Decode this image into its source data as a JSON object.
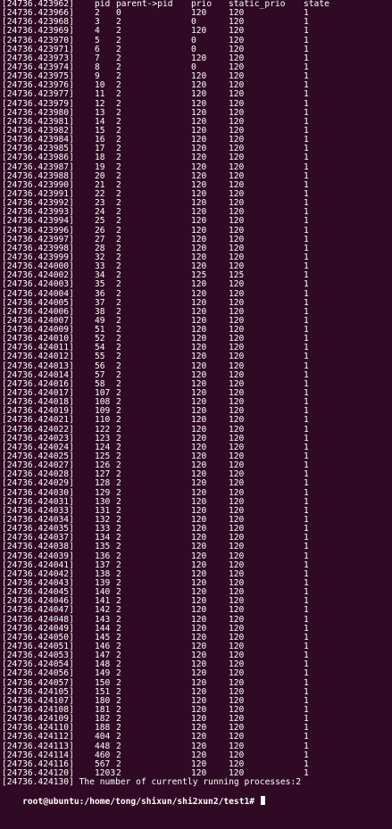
{
  "terminal": {
    "header": {
      "ts": "[24736.423962]",
      "pid": "pid",
      "ppid": "parent->pid",
      "prio": "prio",
      "static_prio": "static_prio",
      "state": "state"
    },
    "rows": [
      {
        "ts": "[24736.423966]",
        "pid": "2",
        "ppid": "0",
        "prio": "120",
        "static_prio": "120",
        "state": "1"
      },
      {
        "ts": "[24736.423968]",
        "pid": "3",
        "ppid": "2",
        "prio": "0",
        "static_prio": "120",
        "state": "1"
      },
      {
        "ts": "[24736.423969]",
        "pid": "4",
        "ppid": "2",
        "prio": "120",
        "static_prio": "120",
        "state": "1"
      },
      {
        "ts": "[24736.423970]",
        "pid": "5",
        "ppid": "2",
        "prio": "0",
        "static_prio": "120",
        "state": "1"
      },
      {
        "ts": "[24736.423971]",
        "pid": "6",
        "ppid": "2",
        "prio": "0",
        "static_prio": "120",
        "state": "1"
      },
      {
        "ts": "[24736.423973]",
        "pid": "7",
        "ppid": "2",
        "prio": "120",
        "static_prio": "120",
        "state": "1"
      },
      {
        "ts": "[24736.423974]",
        "pid": "8",
        "ppid": "2",
        "prio": "0",
        "static_prio": "120",
        "state": "1"
      },
      {
        "ts": "[24736.423975]",
        "pid": "9",
        "ppid": "2",
        "prio": "120",
        "static_prio": "120",
        "state": "1"
      },
      {
        "ts": "[24736.423976]",
        "pid": "10",
        "ppid": "2",
        "prio": "120",
        "static_prio": "120",
        "state": "1"
      },
      {
        "ts": "[24736.423977]",
        "pid": "11",
        "ppid": "2",
        "prio": "120",
        "static_prio": "120",
        "state": "1"
      },
      {
        "ts": "[24736.423979]",
        "pid": "12",
        "ppid": "2",
        "prio": "120",
        "static_prio": "120",
        "state": "1"
      },
      {
        "ts": "[24736.423980]",
        "pid": "13",
        "ppid": "2",
        "prio": "120",
        "static_prio": "120",
        "state": "1"
      },
      {
        "ts": "[24736.423981]",
        "pid": "14",
        "ppid": "2",
        "prio": "120",
        "static_prio": "120",
        "state": "1"
      },
      {
        "ts": "[24736.423982]",
        "pid": "15",
        "ppid": "2",
        "prio": "120",
        "static_prio": "120",
        "state": "1"
      },
      {
        "ts": "[24736.423984]",
        "pid": "16",
        "ppid": "2",
        "prio": "120",
        "static_prio": "120",
        "state": "1"
      },
      {
        "ts": "[24736.423985]",
        "pid": "17",
        "ppid": "2",
        "prio": "120",
        "static_prio": "120",
        "state": "1"
      },
      {
        "ts": "[24736.423986]",
        "pid": "18",
        "ppid": "2",
        "prio": "120",
        "static_prio": "120",
        "state": "1"
      },
      {
        "ts": "[24736.423987]",
        "pid": "19",
        "ppid": "2",
        "prio": "120",
        "static_prio": "120",
        "state": "1"
      },
      {
        "ts": "[24736.423988]",
        "pid": "20",
        "ppid": "2",
        "prio": "120",
        "static_prio": "120",
        "state": "1"
      },
      {
        "ts": "[24736.423990]",
        "pid": "21",
        "ppid": "2",
        "prio": "120",
        "static_prio": "120",
        "state": "1"
      },
      {
        "ts": "[24736.423991]",
        "pid": "22",
        "ppid": "2",
        "prio": "120",
        "static_prio": "120",
        "state": "1"
      },
      {
        "ts": "[24736.423992]",
        "pid": "23",
        "ppid": "2",
        "prio": "120",
        "static_prio": "120",
        "state": "1"
      },
      {
        "ts": "[24736.423993]",
        "pid": "24",
        "ppid": "2",
        "prio": "120",
        "static_prio": "120",
        "state": "1"
      },
      {
        "ts": "[24736.423994]",
        "pid": "25",
        "ppid": "2",
        "prio": "120",
        "static_prio": "120",
        "state": "1"
      },
      {
        "ts": "[24736.423996]",
        "pid": "26",
        "ppid": "2",
        "prio": "120",
        "static_prio": "120",
        "state": "1"
      },
      {
        "ts": "[24736.423997]",
        "pid": "27",
        "ppid": "2",
        "prio": "120",
        "static_prio": "120",
        "state": "1"
      },
      {
        "ts": "[24736.423998]",
        "pid": "28",
        "ppid": "2",
        "prio": "120",
        "static_prio": "120",
        "state": "1"
      },
      {
        "ts": "[24736.423999]",
        "pid": "32",
        "ppid": "2",
        "prio": "120",
        "static_prio": "120",
        "state": "1"
      },
      {
        "ts": "[24736.424000]",
        "pid": "33",
        "ppid": "2",
        "prio": "120",
        "static_prio": "120",
        "state": "1"
      },
      {
        "ts": "[24736.424002]",
        "pid": "34",
        "ppid": "2",
        "prio": "125",
        "static_prio": "125",
        "state": "1"
      },
      {
        "ts": "[24736.424003]",
        "pid": "35",
        "ppid": "2",
        "prio": "120",
        "static_prio": "120",
        "state": "1"
      },
      {
        "ts": "[24736.424004]",
        "pid": "36",
        "ppid": "2",
        "prio": "120",
        "static_prio": "120",
        "state": "1"
      },
      {
        "ts": "[24736.424005]",
        "pid": "37",
        "ppid": "2",
        "prio": "120",
        "static_prio": "120",
        "state": "1"
      },
      {
        "ts": "[24736.424006]",
        "pid": "38",
        "ppid": "2",
        "prio": "120",
        "static_prio": "120",
        "state": "1"
      },
      {
        "ts": "[24736.424007]",
        "pid": "49",
        "ppid": "2",
        "prio": "120",
        "static_prio": "120",
        "state": "1"
      },
      {
        "ts": "[24736.424009]",
        "pid": "51",
        "ppid": "2",
        "prio": "120",
        "static_prio": "120",
        "state": "1"
      },
      {
        "ts": "[24736.424010]",
        "pid": "52",
        "ppid": "2",
        "prio": "120",
        "static_prio": "120",
        "state": "1"
      },
      {
        "ts": "[24736.424011]",
        "pid": "54",
        "ppid": "2",
        "prio": "120",
        "static_prio": "120",
        "state": "1"
      },
      {
        "ts": "[24736.424012]",
        "pid": "55",
        "ppid": "2",
        "prio": "120",
        "static_prio": "120",
        "state": "1"
      },
      {
        "ts": "[24736.424013]",
        "pid": "56",
        "ppid": "2",
        "prio": "120",
        "static_prio": "120",
        "state": "1"
      },
      {
        "ts": "[24736.424014]",
        "pid": "57",
        "ppid": "2",
        "prio": "120",
        "static_prio": "120",
        "state": "1"
      },
      {
        "ts": "[24736.424016]",
        "pid": "58",
        "ppid": "2",
        "prio": "120",
        "static_prio": "120",
        "state": "1"
      },
      {
        "ts": "[24736.424017]",
        "pid": "107",
        "ppid": "2",
        "prio": "120",
        "static_prio": "120",
        "state": "1"
      },
      {
        "ts": "[24736.424018]",
        "pid": "108",
        "ppid": "2",
        "prio": "120",
        "static_prio": "120",
        "state": "1"
      },
      {
        "ts": "[24736.424019]",
        "pid": "109",
        "ppid": "2",
        "prio": "120",
        "static_prio": "120",
        "state": "1"
      },
      {
        "ts": "[24736.424021]",
        "pid": "110",
        "ppid": "2",
        "prio": "120",
        "static_prio": "120",
        "state": "1"
      },
      {
        "ts": "[24736.424022]",
        "pid": "122",
        "ppid": "2",
        "prio": "120",
        "static_prio": "120",
        "state": "1"
      },
      {
        "ts": "[24736.424023]",
        "pid": "123",
        "ppid": "2",
        "prio": "120",
        "static_prio": "120",
        "state": "1"
      },
      {
        "ts": "[24736.424024]",
        "pid": "124",
        "ppid": "2",
        "prio": "120",
        "static_prio": "120",
        "state": "1"
      },
      {
        "ts": "[24736.424025]",
        "pid": "125",
        "ppid": "2",
        "prio": "120",
        "static_prio": "120",
        "state": "1"
      },
      {
        "ts": "[24736.424027]",
        "pid": "126",
        "ppid": "2",
        "prio": "120",
        "static_prio": "120",
        "state": "1"
      },
      {
        "ts": "[24736.424028]",
        "pid": "127",
        "ppid": "2",
        "prio": "120",
        "static_prio": "120",
        "state": "1"
      },
      {
        "ts": "[24736.424029]",
        "pid": "128",
        "ppid": "2",
        "prio": "120",
        "static_prio": "120",
        "state": "1"
      },
      {
        "ts": "[24736.424030]",
        "pid": "129",
        "ppid": "2",
        "prio": "120",
        "static_prio": "120",
        "state": "1"
      },
      {
        "ts": "[24736.424031]",
        "pid": "130",
        "ppid": "2",
        "prio": "120",
        "static_prio": "120",
        "state": "1"
      },
      {
        "ts": "[24736.424033]",
        "pid": "131",
        "ppid": "2",
        "prio": "120",
        "static_prio": "120",
        "state": "1"
      },
      {
        "ts": "[24736.424034]",
        "pid": "132",
        "ppid": "2",
        "prio": "120",
        "static_prio": "120",
        "state": "1"
      },
      {
        "ts": "[24736.424035]",
        "pid": "133",
        "ppid": "2",
        "prio": "120",
        "static_prio": "120",
        "state": "1"
      },
      {
        "ts": "[24736.424037]",
        "pid": "134",
        "ppid": "2",
        "prio": "120",
        "static_prio": "120",
        "state": "1"
      },
      {
        "ts": "[24736.424038]",
        "pid": "135",
        "ppid": "2",
        "prio": "120",
        "static_prio": "120",
        "state": "1"
      },
      {
        "ts": "[24736.424039]",
        "pid": "136",
        "ppid": "2",
        "prio": "120",
        "static_prio": "120",
        "state": "1"
      },
      {
        "ts": "[24736.424041]",
        "pid": "137",
        "ppid": "2",
        "prio": "120",
        "static_prio": "120",
        "state": "1"
      },
      {
        "ts": "[24736.424042]",
        "pid": "138",
        "ppid": "2",
        "prio": "120",
        "static_prio": "120",
        "state": "1"
      },
      {
        "ts": "[24736.424043]",
        "pid": "139",
        "ppid": "2",
        "prio": "120",
        "static_prio": "120",
        "state": "1"
      },
      {
        "ts": "[24736.424045]",
        "pid": "140",
        "ppid": "2",
        "prio": "120",
        "static_prio": "120",
        "state": "1"
      },
      {
        "ts": "[24736.424046]",
        "pid": "141",
        "ppid": "2",
        "prio": "120",
        "static_prio": "120",
        "state": "1"
      },
      {
        "ts": "[24736.424047]",
        "pid": "142",
        "ppid": "2",
        "prio": "120",
        "static_prio": "120",
        "state": "1"
      },
      {
        "ts": "[24736.424048]",
        "pid": "143",
        "ppid": "2",
        "prio": "120",
        "static_prio": "120",
        "state": "1"
      },
      {
        "ts": "[24736.424049]",
        "pid": "144",
        "ppid": "2",
        "prio": "120",
        "static_prio": "120",
        "state": "1"
      },
      {
        "ts": "[24736.424050]",
        "pid": "145",
        "ppid": "2",
        "prio": "120",
        "static_prio": "120",
        "state": "1"
      },
      {
        "ts": "[24736.424051]",
        "pid": "146",
        "ppid": "2",
        "prio": "120",
        "static_prio": "120",
        "state": "1"
      },
      {
        "ts": "[24736.424053]",
        "pid": "147",
        "ppid": "2",
        "prio": "120",
        "static_prio": "120",
        "state": "1"
      },
      {
        "ts": "[24736.424054]",
        "pid": "148",
        "ppid": "2",
        "prio": "120",
        "static_prio": "120",
        "state": "1"
      },
      {
        "ts": "[24736.424056]",
        "pid": "149",
        "ppid": "2",
        "prio": "120",
        "static_prio": "120",
        "state": "1"
      },
      {
        "ts": "[24736.424057]",
        "pid": "150",
        "ppid": "2",
        "prio": "120",
        "static_prio": "120",
        "state": "1"
      },
      {
        "ts": "[24736.424105]",
        "pid": "151",
        "ppid": "2",
        "prio": "120",
        "static_prio": "120",
        "state": "1"
      },
      {
        "ts": "[24736.424107]",
        "pid": "180",
        "ppid": "2",
        "prio": "120",
        "static_prio": "120",
        "state": "1"
      },
      {
        "ts": "[24736.424108]",
        "pid": "181",
        "ppid": "2",
        "prio": "120",
        "static_prio": "120",
        "state": "1"
      },
      {
        "ts": "[24736.424109]",
        "pid": "182",
        "ppid": "2",
        "prio": "120",
        "static_prio": "120",
        "state": "1"
      },
      {
        "ts": "[24736.424110]",
        "pid": "188",
        "ppid": "2",
        "prio": "120",
        "static_prio": "120",
        "state": "1"
      },
      {
        "ts": "[24736.424112]",
        "pid": "404",
        "ppid": "2",
        "prio": "120",
        "static_prio": "120",
        "state": "1"
      },
      {
        "ts": "[24736.424113]",
        "pid": "448",
        "ppid": "2",
        "prio": "120",
        "static_prio": "120",
        "state": "1"
      },
      {
        "ts": "[24736.424114]",
        "pid": "460",
        "ppid": "2",
        "prio": "120",
        "static_prio": "120",
        "state": "1"
      },
      {
        "ts": "[24736.424116]",
        "pid": "567",
        "ppid": "2",
        "prio": "120",
        "static_prio": "120",
        "state": "1"
      },
      {
        "ts": "[24736.424120]",
        "pid": "1203",
        "ppid": "2",
        "prio": "120",
        "static_prio": "120",
        "state": "1"
      }
    ],
    "summary_line": "[24736.424130] The number of currently running processes:2",
    "prompt": "root@ubuntu:/home/tong/shixun/shi2xun2/test1#",
    "colors": {
      "background": "#300a24",
      "foreground": "#ffffff"
    }
  }
}
